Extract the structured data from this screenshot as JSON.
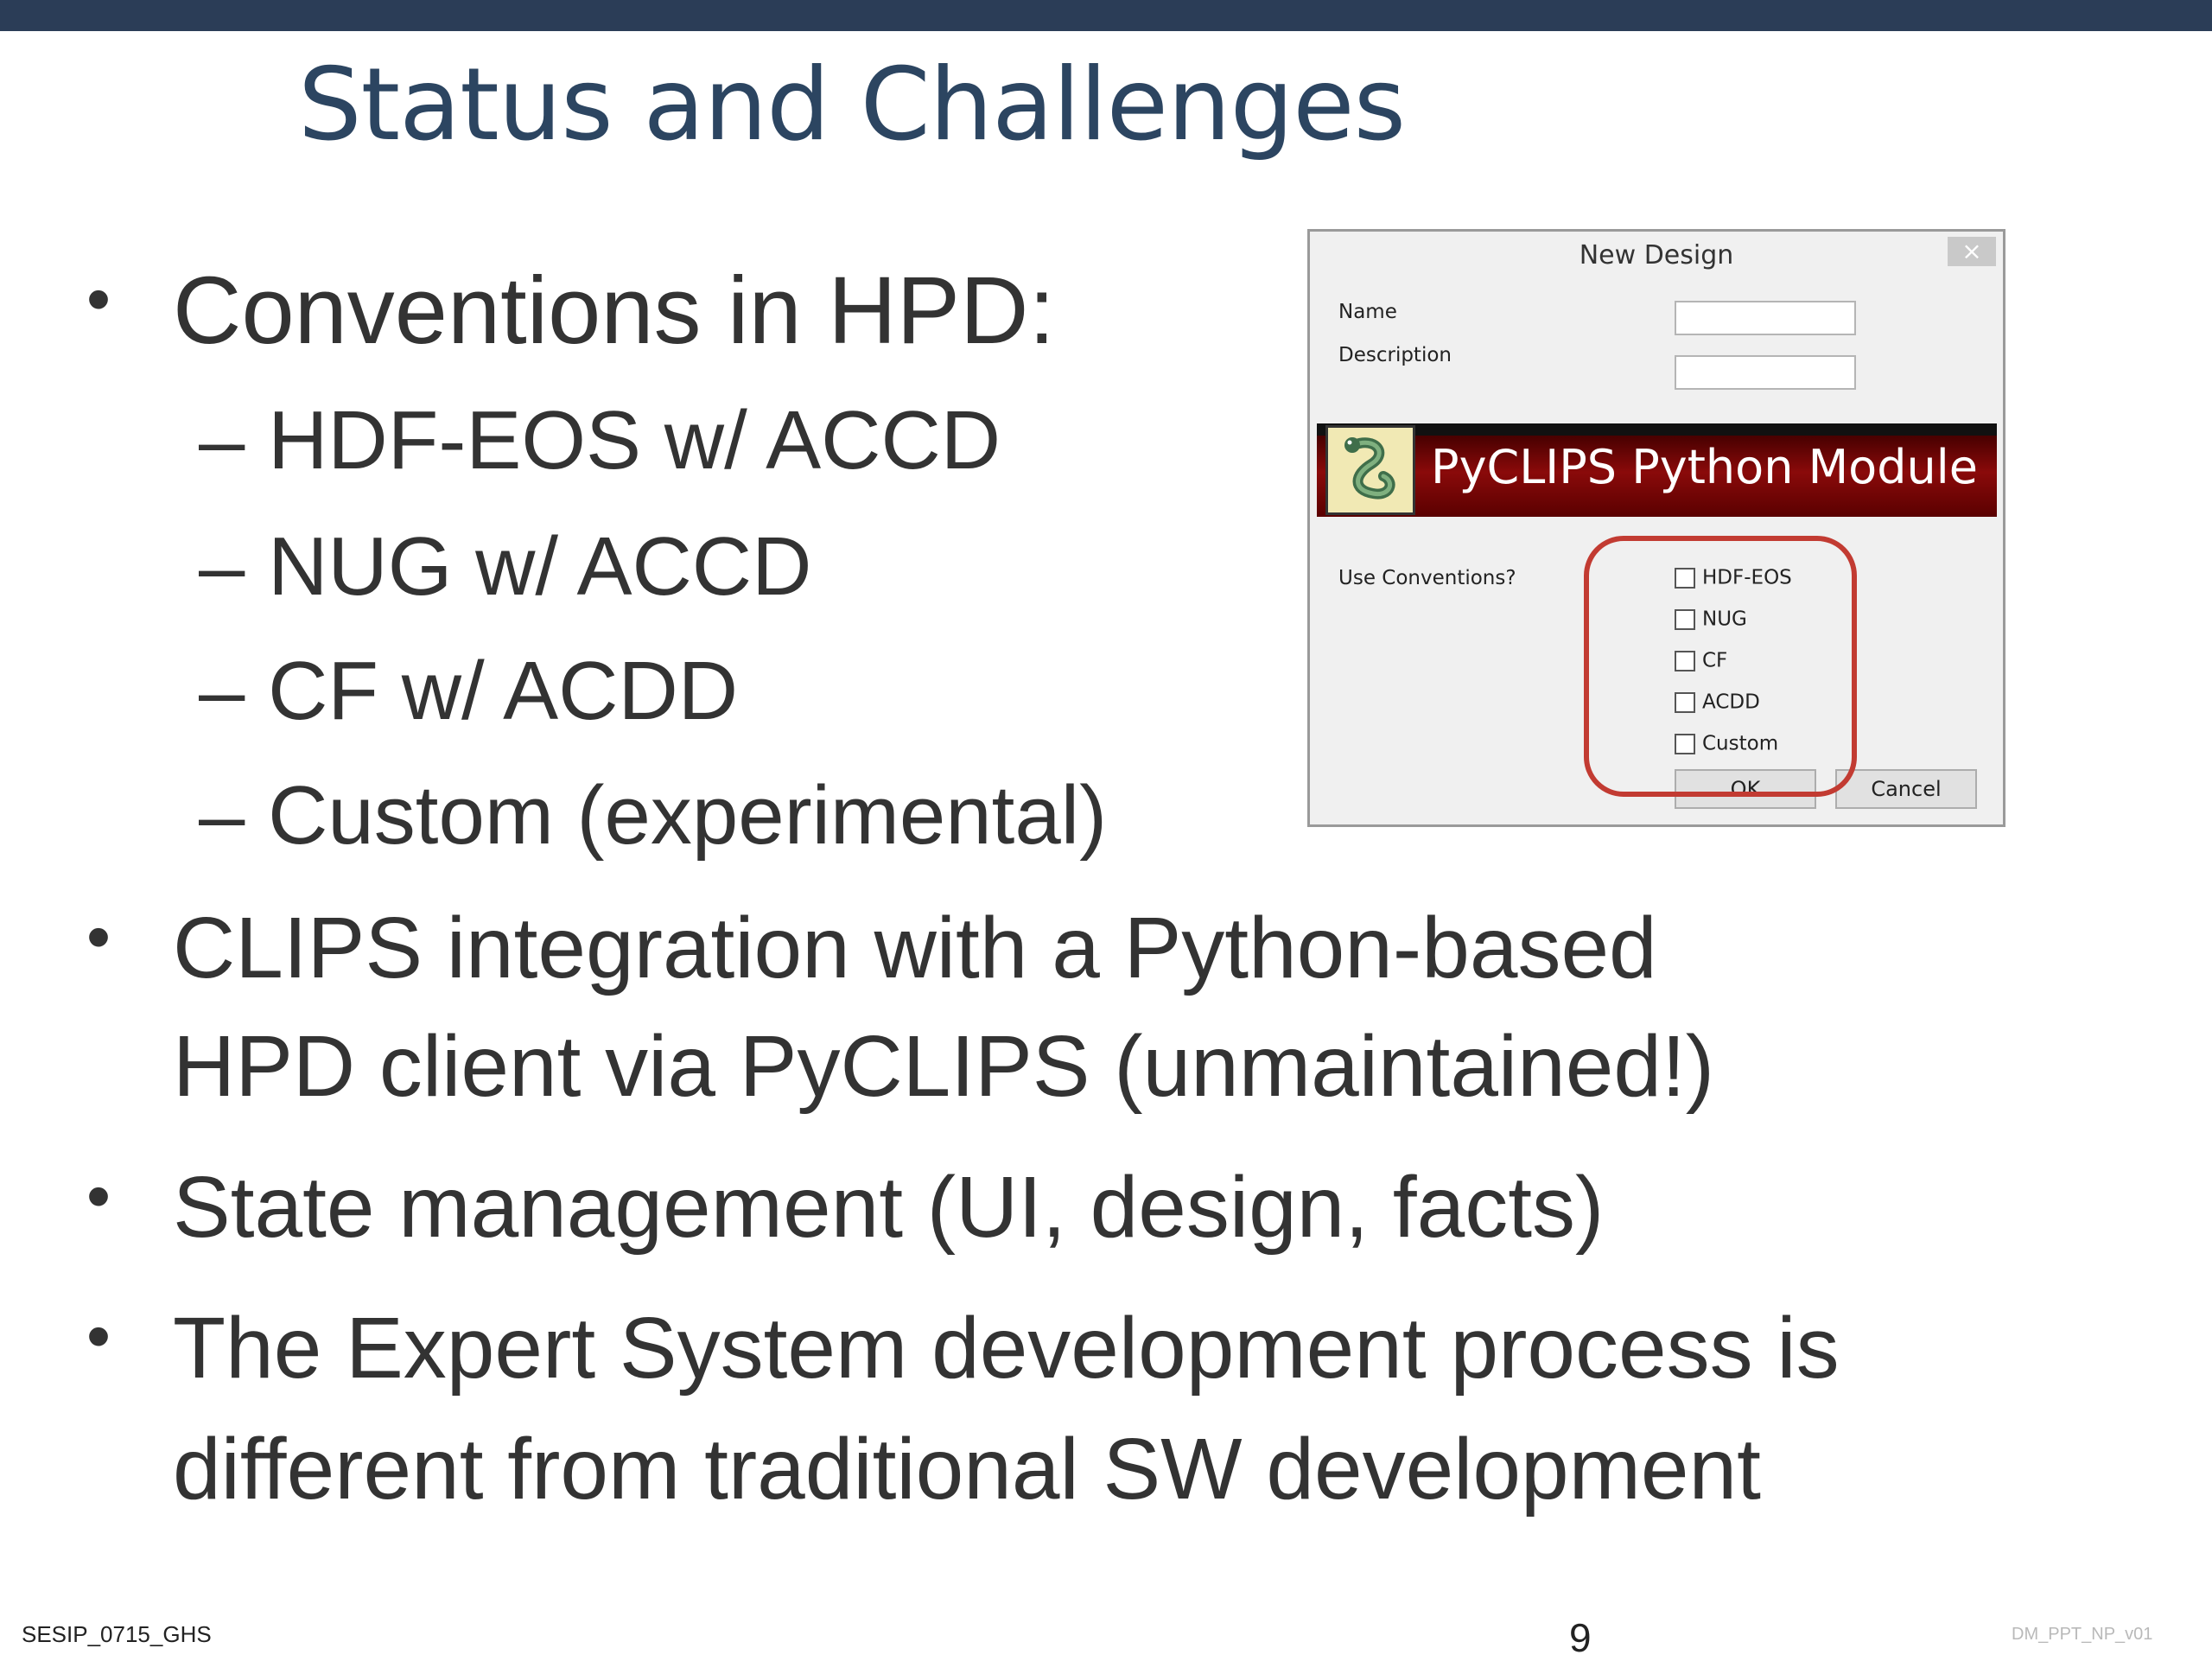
{
  "slide": {
    "title": "Status and Challenges",
    "bullets": [
      "Conventions in HPD:",
      "CLIPS integration with a Python-based",
      "HPD client via PyCLIPS (unmaintained!)",
      "State management (UI, design, facts)",
      "The Expert System development process is",
      "different from traditional SW development"
    ],
    "sub_bullets": [
      "– HDF-EOS w/ ACCD",
      "– NUG w/ ACCD",
      "– CF w/ ACDD",
      "– Custom (experimental)"
    ],
    "bullet_glyph": "•"
  },
  "dialog": {
    "title": "New Design",
    "close_icon": "×",
    "name_label": "Name",
    "description_label": "Description",
    "name_value": "",
    "description_value": "",
    "banner_text": "PyCLIPS Python Module",
    "banner_logo": "snake-logo-icon",
    "conventions_label": "Use Conventions?",
    "conventions": [
      {
        "label": "HDF-EOS",
        "checked": false
      },
      {
        "label": "NUG",
        "checked": false
      },
      {
        "label": "CF",
        "checked": false
      },
      {
        "label": "ACDD",
        "checked": false
      },
      {
        "label": "Custom",
        "checked": false
      }
    ],
    "ok_label": "OK",
    "cancel_label": "Cancel",
    "highlight_color": "#c23b32"
  },
  "footer": {
    "left": "SESIP_0715_GHS",
    "page": "9",
    "right": "DM_PPT_NP_v01"
  },
  "colors": {
    "top_bar": "#2b3d57",
    "title": "#2c4561",
    "body_text": "#333333",
    "banner": "#8a0a0a"
  }
}
